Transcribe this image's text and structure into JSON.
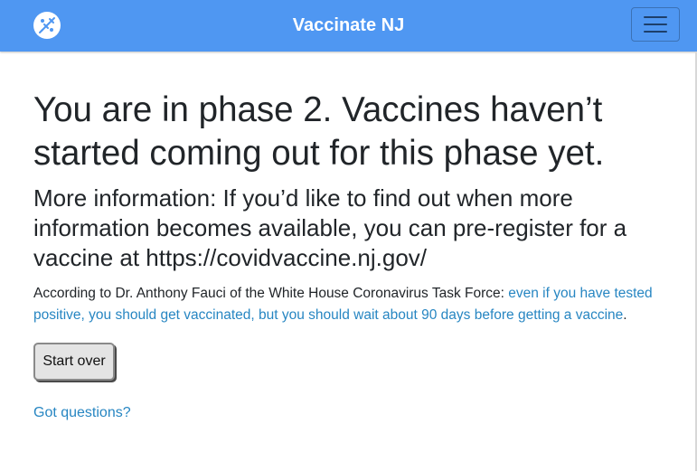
{
  "header": {
    "brand": "Vaccinate NJ",
    "logo_icon": "vaccine-syringe-icon",
    "menu_icon": "hamburger-menu-icon",
    "background_color": "#4f97f2"
  },
  "main": {
    "heading": "You are in phase 2. Vaccines haven’t started coming out for this phase yet.",
    "subheading": "More information: If you’d like to find out when more information becomes available, you can pre-register for a vaccine at https://covidvaccine.nj.gov/",
    "quote_prefix": "According to Dr. Anthony Fauci of the White House Coronavirus Task Force: ",
    "quote_link": "even if you have tested positive, you should get vaccinated, but you should wait about 90 days before getting a vaccine",
    "quote_suffix": ".",
    "start_over_label": "Start over",
    "questions_link": "Got questions?",
    "link_color": "#2786c2"
  }
}
